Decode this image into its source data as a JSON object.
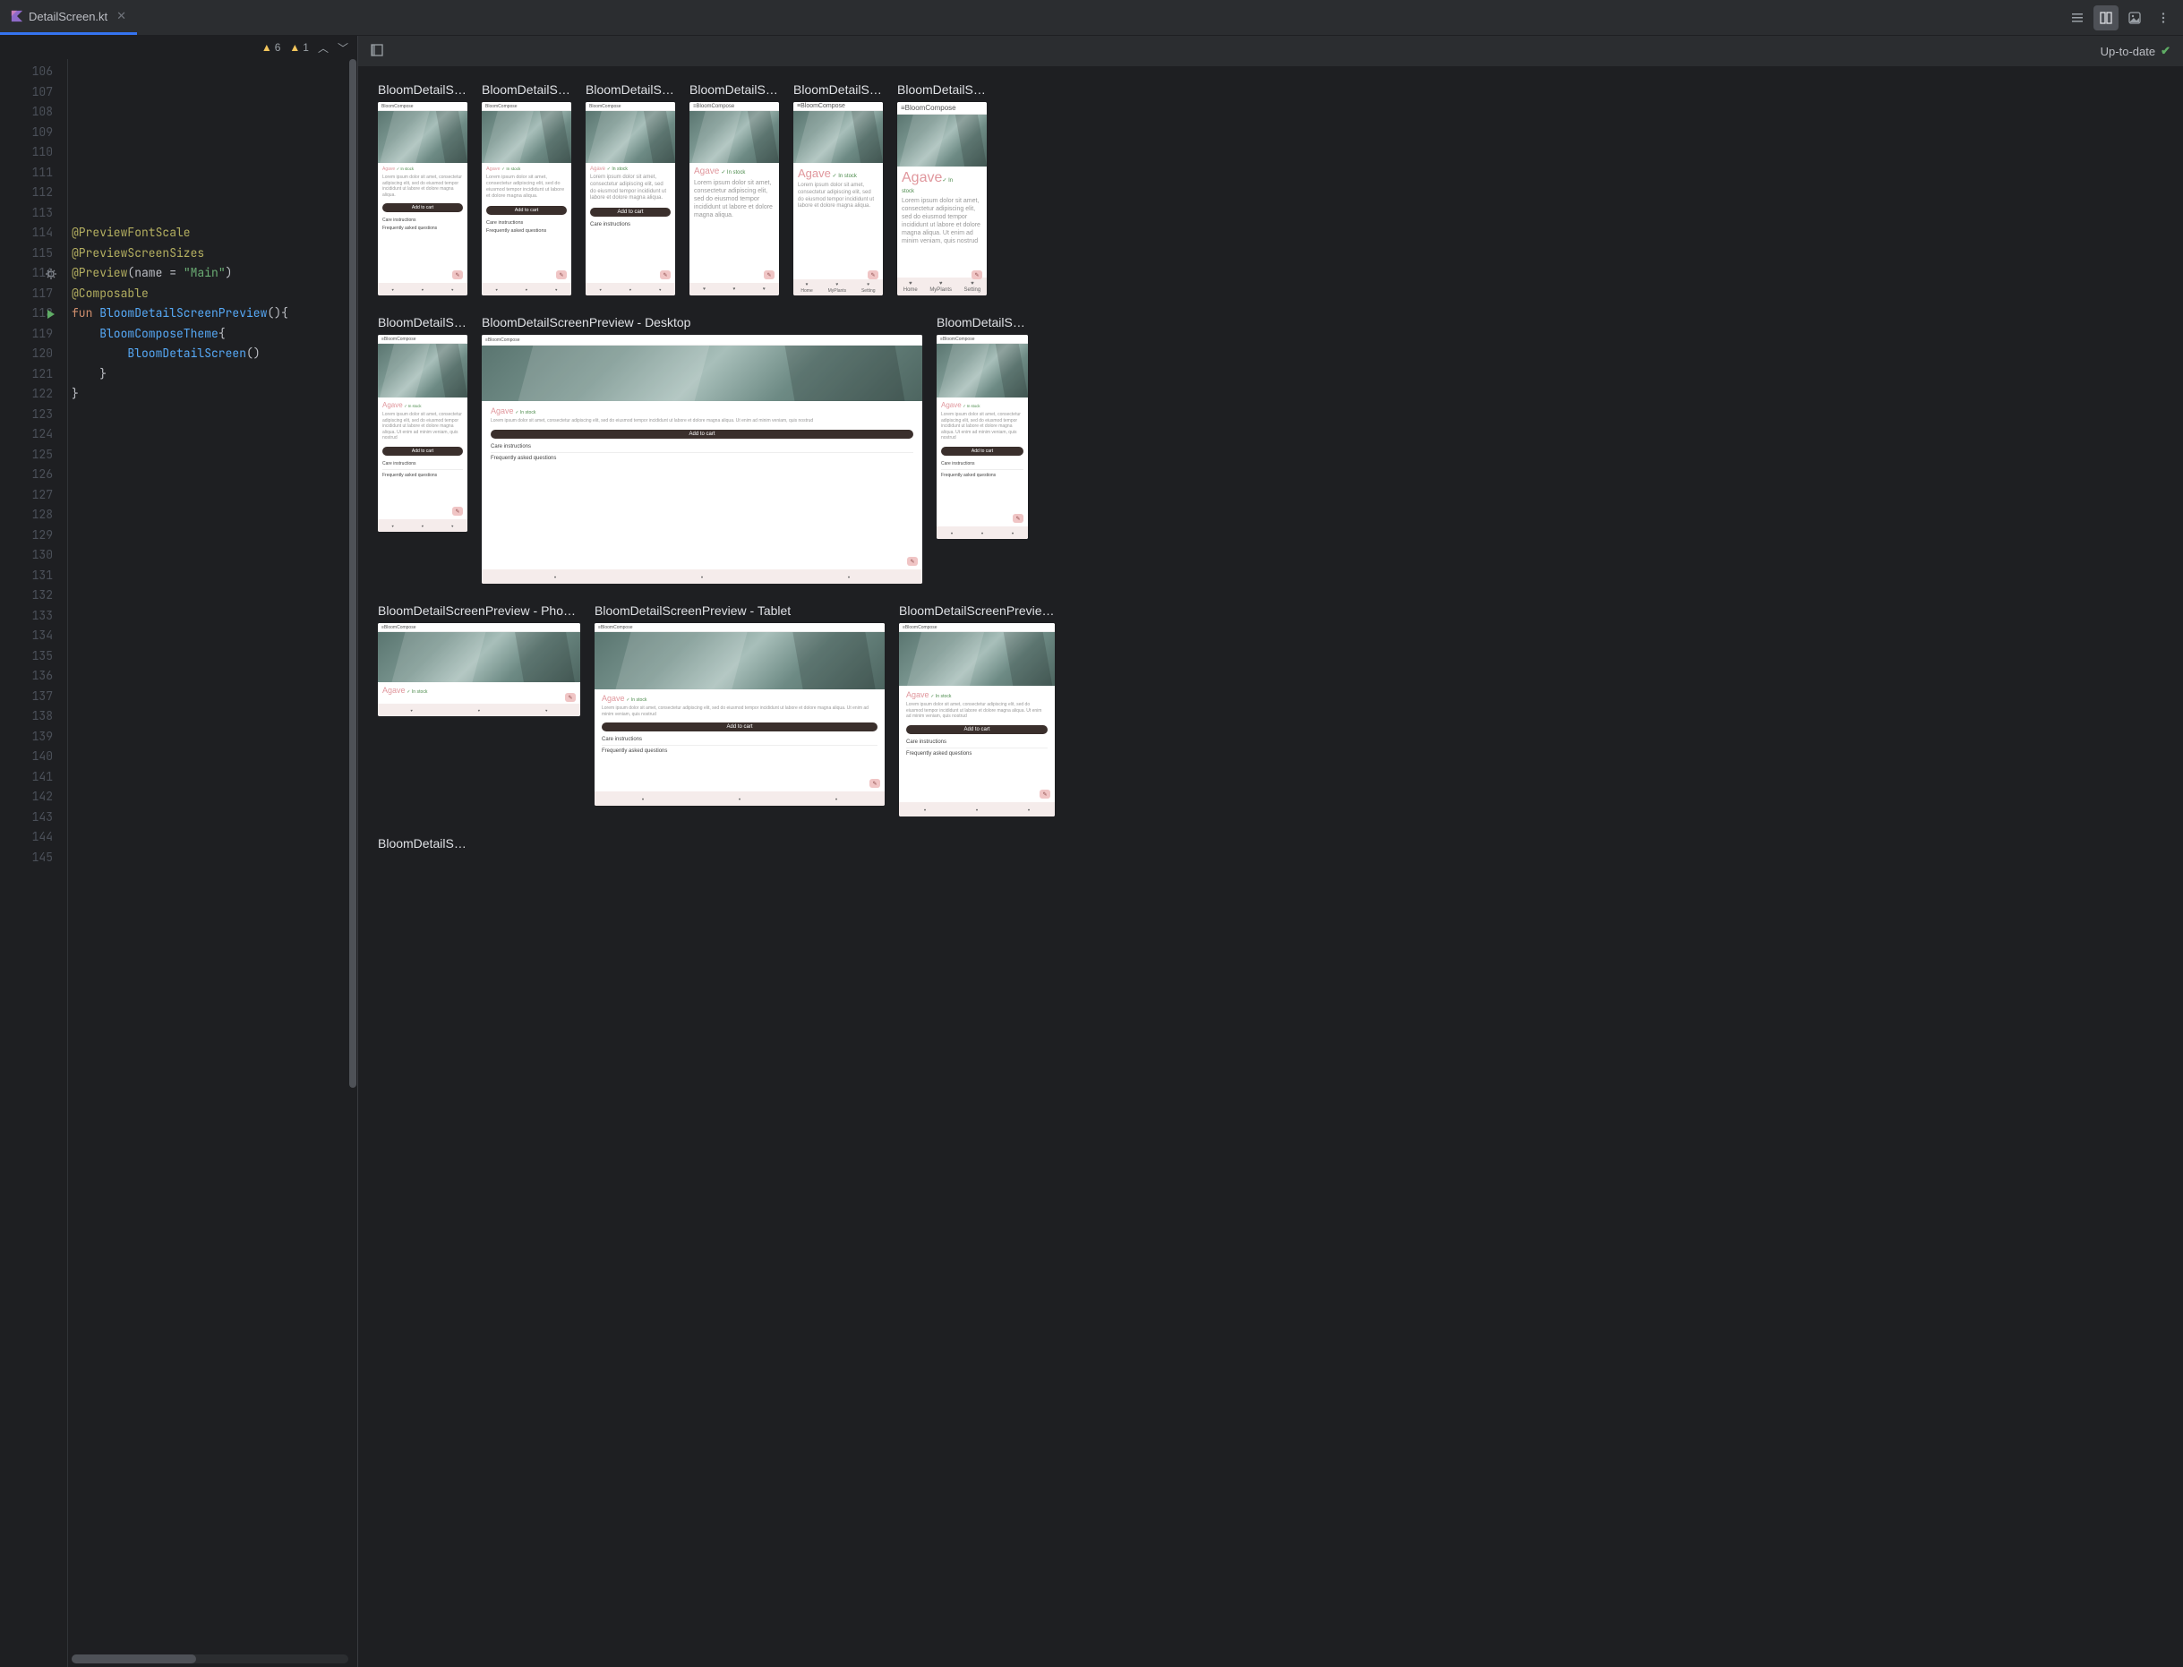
{
  "tab": {
    "filename": "DetailScreen.kt"
  },
  "inspections": {
    "warn1_count": "6",
    "warn2_count": "1"
  },
  "gutter": {
    "start": 106,
    "end": 145
  },
  "code": {
    "l114_ann": "@PreviewFontScale",
    "l115_ann": "@PreviewScreenSizes",
    "l116_ann": "@Preview",
    "l116_args_open": "(name = ",
    "l116_str": "\"Main\"",
    "l116_args_close": ")",
    "l117_ann": "@Composable",
    "l118_kw": "fun ",
    "l118_fn": "BloomDetailScreenPreview",
    "l118_tail": "(){",
    "l119_fn": "BloomComposeTheme",
    "l119_tail": "{",
    "l120_fn": "BloomDetailScreen",
    "l120_tail": "()",
    "l121": "}",
    "l122": "}"
  },
  "preview": {
    "status": "Up-to-date",
    "labels": {
      "r1_1": "BloomDetailSc…",
      "r1_2": "BloomDetailSc…",
      "r1_3": "BloomDetailSc…",
      "r1_4": "BloomDetailSc…",
      "r1_5": "BloomDetailSc…",
      "r1_6": "BloomDetailSc…",
      "r2_1": "BloomDetailSc…",
      "r2_2": "BloomDetailScreenPreview - Desktop",
      "r2_3": "BloomDetailSc…",
      "r3_1": "BloomDetailScreenPreview - Pho…",
      "r3_2": "BloomDetailScreenPreview - Tablet",
      "r3_3": "BloomDetailScreenPrevie…",
      "r4_1": "BloomDetailSc…"
    },
    "content": {
      "app_title": "BloomCompose",
      "plant_name": "Agave",
      "in_stock": "In stock",
      "in_stock_short": "✓ In stock",
      "lorem_short": "Lorem ipsum dolor sit amet, consectetur adipiscing elit, sed do eiusmod tempor incididunt ut labore et dolore magna aliqua.",
      "lorem_long": "Lorem ipsum dolor sit amet, consectetur adipiscing elit, sed do eiusmod tempor incididunt ut labore et dolore magna aliqua. Ut enim ad minim veniam, quis nostrud",
      "add_to_cart": "Add to cart",
      "care": "Care instructions",
      "faq": "Frequently asked questions",
      "nav_home": "Home",
      "nav_myplants": "MyPlants",
      "nav_setting": "Setting"
    }
  }
}
